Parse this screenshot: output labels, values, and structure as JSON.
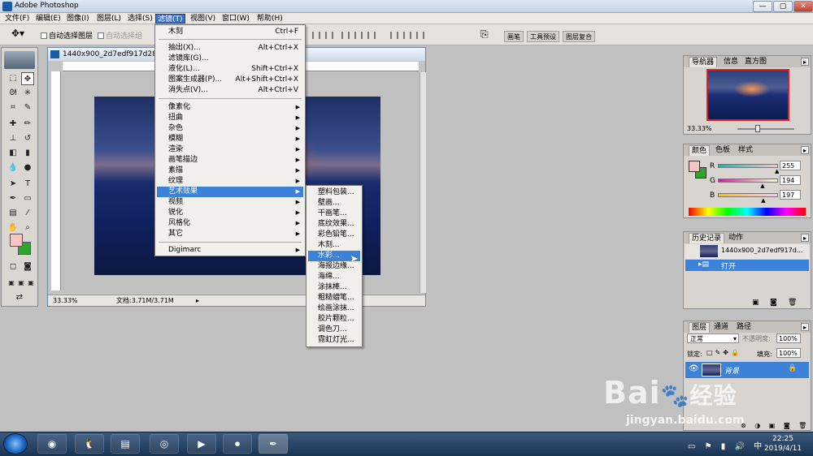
{
  "window": {
    "title": "Adobe Photoshop",
    "controls": [
      "—",
      "▢",
      "✕"
    ]
  },
  "menubar": [
    {
      "label": "文件(F)"
    },
    {
      "label": "编辑(E)"
    },
    {
      "label": "图像(I)"
    },
    {
      "label": "图层(L)"
    },
    {
      "label": "选择(S)"
    },
    {
      "label": "滤镜(T)"
    },
    {
      "label": "视图(V)"
    },
    {
      "label": "窗口(W)"
    },
    {
      "label": "帮助(H)"
    }
  ],
  "options": {
    "auto_select_layer": "自动选择图层",
    "auto_select_group": "自动选择组"
  },
  "palette_well": [
    "画笔",
    "工具预设",
    "图层复合"
  ],
  "document": {
    "title": "1440x900_2d7edf917d288",
    "zoom": "33.33%",
    "doc_size": "文档:3.71M/3.71M"
  },
  "filter_menu": {
    "items": [
      {
        "label": "木刻",
        "shortcut": "Ctrl+F"
      },
      {
        "label": "抽出(X)...",
        "shortcut": "Alt+Ctrl+X"
      },
      {
        "label": "滤镜库(G)...",
        "shortcut": ""
      },
      {
        "label": "液化(L)...",
        "shortcut": "Shift+Ctrl+X"
      },
      {
        "label": "图案生成器(P)...",
        "shortcut": "Alt+Shift+Ctrl+X"
      },
      {
        "label": "消失点(V)...",
        "shortcut": "Alt+Ctrl+V"
      }
    ],
    "submenus": [
      "像素化",
      "扭曲",
      "杂色",
      "模糊",
      "渲染",
      "画笔描边",
      "素描",
      "纹理",
      "艺术效果",
      "视频",
      "锐化",
      "风格化",
      "其它"
    ],
    "digimarc": "Digimarc"
  },
  "artistic_submenu": [
    "塑料包装...",
    "壁画...",
    "干画笔...",
    "底纹效果...",
    "彩色铅笔...",
    "木刻...",
    "水彩...",
    "海报边缘...",
    "海绵...",
    "涂抹棒...",
    "粗糙蜡笔...",
    "绘画涂抹...",
    "胶片颗粒...",
    "调色刀...",
    "霓虹灯光..."
  ],
  "navigator": {
    "tabs": [
      "导航器",
      "信息",
      "直方图"
    ],
    "zoom": "33.33%"
  },
  "color_panel": {
    "tabs": [
      "颜色",
      "色板",
      "样式"
    ],
    "r_label": "R",
    "g_label": "G",
    "b_label": "B",
    "r": 255,
    "g": 194,
    "b": 197,
    "r_text": "255",
    "g_text": "194",
    "b_text": "197"
  },
  "history_panel": {
    "tabs": [
      "历史记录",
      "动作"
    ],
    "snapshot": "1440x900_2d7edf917d...",
    "step": "打开"
  },
  "layers_panel": {
    "tabs": [
      "图层",
      "通道",
      "路径"
    ],
    "blend_mode": "正常",
    "opacity_label": "不透明度:",
    "opacity": "100%",
    "lock_label": "锁定:",
    "fill_label": "填充:",
    "fill": "100%",
    "layer_name": "背景"
  },
  "taskbar": {
    "time": "22:25",
    "date": "2019/4/11"
  },
  "watermark": {
    "brand": "Bai",
    "brand2": "经验",
    "url": "jingyan.baidu.com"
  },
  "colors": {
    "accent": "#3b82d8",
    "foreground": "#f9c3c5",
    "background": "#2fa42f"
  }
}
